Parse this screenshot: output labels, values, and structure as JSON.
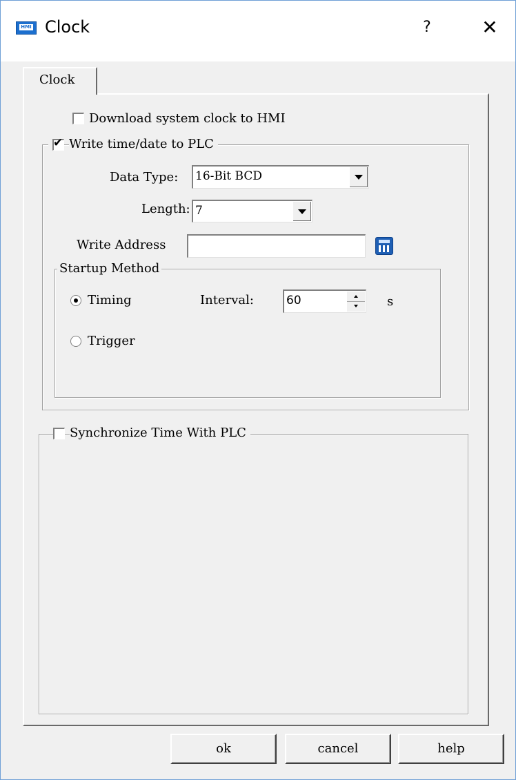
{
  "window": {
    "title": "Clock",
    "help_glyph": "?",
    "close_glyph": "✕",
    "icon_text": "HMI"
  },
  "tab": {
    "label": "Clock"
  },
  "download_clock": {
    "label": "Download system clock to HMI",
    "checked": false
  },
  "write_group": {
    "label": "Write time/date to PLC",
    "checked": true,
    "data_type_label": "Data Type:",
    "data_type_value": "16-Bit BCD",
    "length_label": "Length:",
    "length_value": "7",
    "write_address_label": "Write Address",
    "write_address_value": "",
    "startup_method": {
      "legend": "Startup Method",
      "timing_label": "Timing",
      "timing_selected": true,
      "interval_label": "Interval:",
      "interval_value": "60",
      "interval_unit": "s",
      "trigger_label": "Trigger",
      "trigger_selected": false
    }
  },
  "sync_group": {
    "label": "Synchronize Time With PLC",
    "checked": false
  },
  "buttons": {
    "ok": "ok",
    "cancel": "cancel",
    "help": "help"
  },
  "icons": {
    "title_icon": "hmi-icon",
    "calculator": "calculator-icon"
  }
}
